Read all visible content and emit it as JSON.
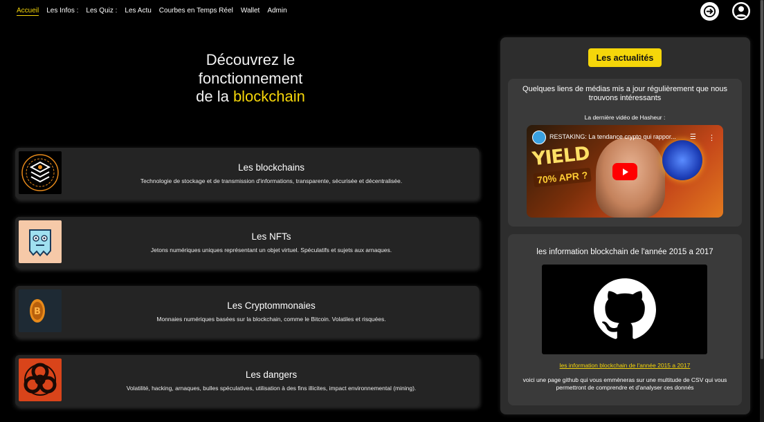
{
  "nav": {
    "links": [
      "Accueil",
      "Les Infos :",
      "Les Quiz :",
      "Les Actu",
      "Courbes en Temps Réel",
      "Wallet",
      "Admin"
    ],
    "active_index": 0,
    "logout_icon": "logout-icon",
    "profile_icon": "user-icon"
  },
  "hero": {
    "line1": "Découvrez le",
    "line2": "fonctionnement",
    "line3_prefix": "de la ",
    "line3_highlight": "blockchain"
  },
  "cards": [
    {
      "title": "Les blockchains",
      "desc": "Technologie de stockage et de transmission d'informations, transparente, sécurisée et décentralisée.",
      "icon": "blockchain-cube-icon"
    },
    {
      "title": "Les NFTs",
      "desc": "Jetons numériques uniques représentant un objet virtuel. Spéculatifs et sujets aux arnaques.",
      "icon": "nft-ghost-icon"
    },
    {
      "title": "Les Cryptommonaies",
      "desc": "Monnaies numériques basées sur la blockchain, comme le Bitcoin. Volatiles et risquées.",
      "icon": "bitcoin-icon"
    },
    {
      "title": "Les dangers",
      "desc": "Volatilité, hacking, arnaques, bulles spéculatives, utilisation à des fins illicites, impact environnemental (mining).",
      "icon": "biohazard-icon"
    }
  ],
  "panel": {
    "news_button": "Les actualités",
    "media": {
      "title": "Quelques liens de médias mis a jour régulièrement que nous trouvons intéressants",
      "video_label": "La dernière vidéo de Hasheur :",
      "video_title": "RESTAKING: La tendance crypto qui rappor...",
      "thumb_text1": "YIELD",
      "thumb_text2": "70% APR ?"
    },
    "github": {
      "title": "les information blockchain de l'année 2015 a 2017",
      "link": "les information blockchain de l'année 2015 a 2017",
      "desc": "voici une page github qui vous emmèneras sur une multitude de CSV qui vous permettront de comprendre et d'analyser ces donnés",
      "icon": "github-icon"
    }
  },
  "colors": {
    "accent": "#f5d60a",
    "card_bg": "#242424",
    "panel_bg": "#2d2d2d"
  }
}
